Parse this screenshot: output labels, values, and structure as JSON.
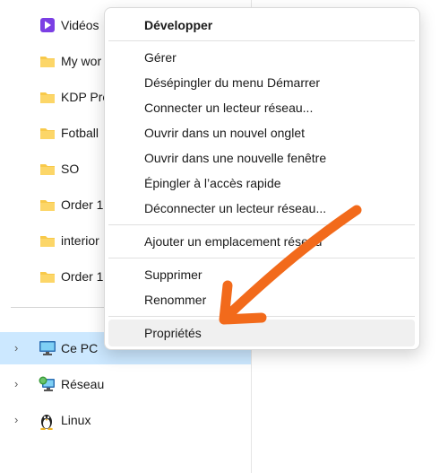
{
  "nav": {
    "folders": [
      {
        "label": "Vidéos",
        "icon": "videos-icon"
      },
      {
        "label": "My wor",
        "icon": "folder-icon"
      },
      {
        "label": "KDP Pre",
        "icon": "folder-icon"
      },
      {
        "label": "Fotball",
        "icon": "folder-icon"
      },
      {
        "label": "SO",
        "icon": "folder-icon"
      },
      {
        "label": "Order 1",
        "icon": "folder-icon"
      },
      {
        "label": "interior",
        "icon": "folder-icon"
      },
      {
        "label": "Order 1",
        "icon": "folder-icon"
      }
    ],
    "devices": [
      {
        "label": "Ce PC",
        "icon": "computer-icon",
        "selected": true
      },
      {
        "label": "Réseau",
        "icon": "network-icon",
        "selected": false
      },
      {
        "label": "Linux",
        "icon": "linux-penguin-icon",
        "selected": false
      }
    ]
  },
  "context_menu": {
    "header": "Développer",
    "group1": [
      "Gérer",
      "Désépingler du menu Démarrer",
      "Connecter un lecteur réseau...",
      "Ouvrir dans un nouvel onglet",
      "Ouvrir dans une nouvelle fenêtre",
      "Épingler à l’accès rapide",
      "Déconnecter un lecteur réseau..."
    ],
    "group2": [
      "Ajouter un emplacement réseau"
    ],
    "group3": [
      "Supprimer",
      "Renommer"
    ],
    "group4": [
      "Propriétés"
    ],
    "highlighted": "Propriétés"
  },
  "colors": {
    "selection": "#cce8ff",
    "folder": "#f8c94a",
    "menu_hover": "#f0f0f0",
    "annotation_arrow": "#f26a1b"
  }
}
